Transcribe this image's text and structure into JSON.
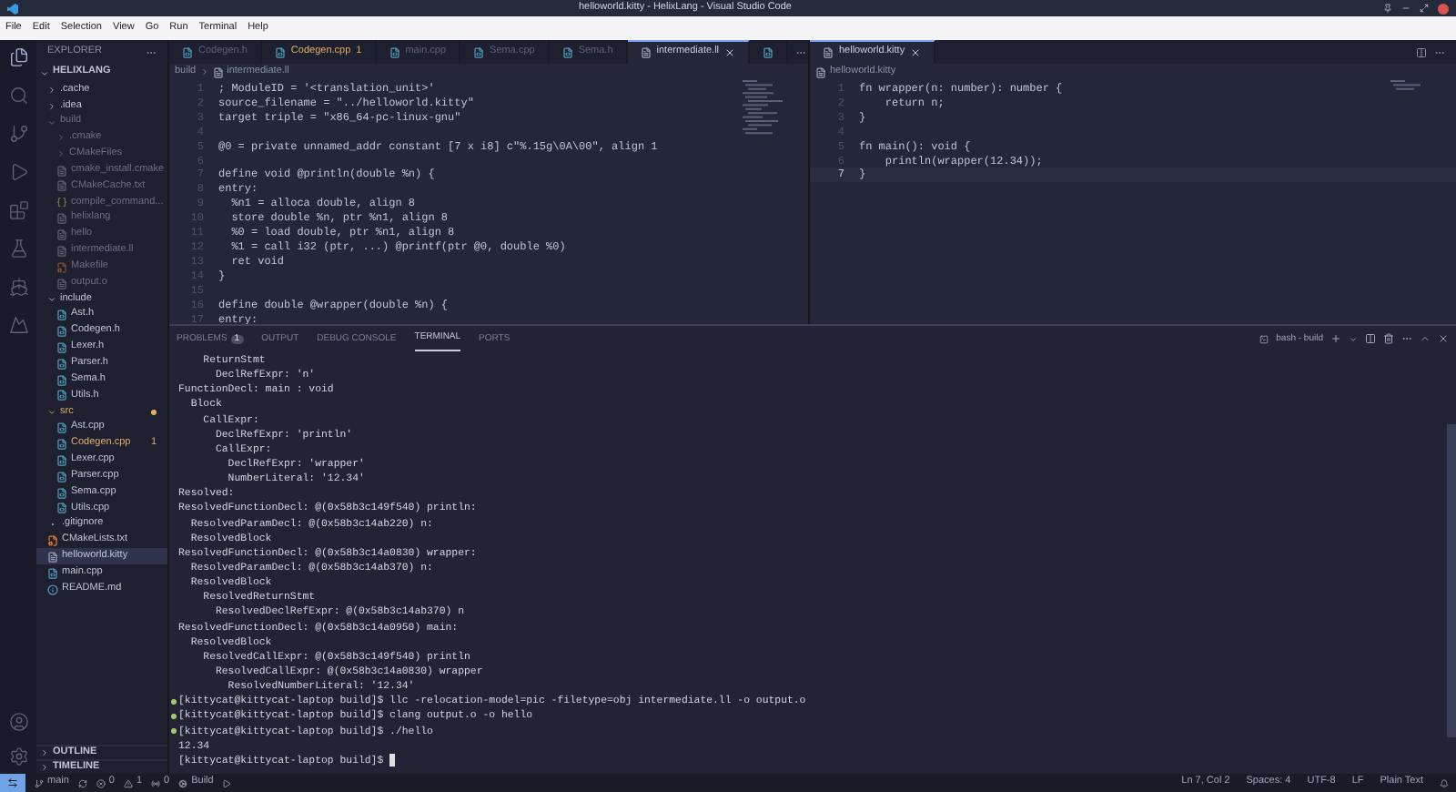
{
  "window": {
    "title": "helloworld.kitty - HelixLang - Visual Studio Code"
  },
  "menu": [
    "File",
    "Edit",
    "Selection",
    "View",
    "Go",
    "Run",
    "Terminal",
    "Help"
  ],
  "activity_bar": [
    {
      "kind": "files",
      "selected": true
    },
    {
      "kind": "search",
      "selected": false
    },
    {
      "kind": "branch",
      "selected": false
    },
    {
      "kind": "run",
      "selected": false
    },
    {
      "kind": "extensions",
      "selected": false
    },
    {
      "kind": "flask",
      "selected": false
    },
    {
      "kind": "ship",
      "selected": false
    },
    {
      "kind": "mountain",
      "selected": false
    }
  ],
  "explorer": {
    "title": "EXPLORER",
    "project": "HELIXLANG",
    "tree": [
      {
        "name": ".cache",
        "kind": "folder",
        "expanded": false,
        "dimmed": false
      },
      {
        "name": ".idea",
        "kind": "folder",
        "expanded": false,
        "dimmed": false
      },
      {
        "name": "build",
        "kind": "folder",
        "expanded": true,
        "dimmed": true,
        "children": [
          {
            "name": ".cmake",
            "kind": "folder",
            "expanded": false,
            "dimmed": true
          },
          {
            "name": "CMakeFiles",
            "kind": "folder",
            "expanded": false,
            "dimmed": true
          },
          {
            "name": "cmake_install.cmake",
            "kind": "text",
            "dimmed": true,
            "selected": false
          },
          {
            "name": "CMakeCache.txt",
            "kind": "text",
            "dimmed": true,
            "selected": false
          },
          {
            "name": "compile_command...",
            "kind": "json",
            "dimmed": true,
            "selected": false
          },
          {
            "name": "helixlang",
            "kind": "text",
            "dimmed": true,
            "selected": false
          },
          {
            "name": "hello",
            "kind": "text",
            "dimmed": true,
            "selected": false
          },
          {
            "name": "intermediate.ll",
            "kind": "text",
            "dimmed": true,
            "selected": false
          },
          {
            "name": "Makefile",
            "kind": "make",
            "dimmed": true,
            "selected": false
          },
          {
            "name": "output.o",
            "kind": "text",
            "dimmed": true,
            "selected": false
          }
        ]
      },
      {
        "name": "include",
        "kind": "folder",
        "expanded": true,
        "dimmed": false,
        "children": [
          {
            "name": "Ast.h",
            "kind": "c",
            "dimmed": false,
            "selected": false
          },
          {
            "name": "Codegen.h",
            "kind": "c",
            "dimmed": false,
            "selected": false
          },
          {
            "name": "Lexer.h",
            "kind": "c",
            "dimmed": false,
            "selected": false
          },
          {
            "name": "Parser.h",
            "kind": "c",
            "dimmed": false,
            "selected": false
          },
          {
            "name": "Sema.h",
            "kind": "c",
            "dimmed": false,
            "selected": false
          },
          {
            "name": "Utils.h",
            "kind": "c",
            "dimmed": false,
            "selected": false
          }
        ]
      },
      {
        "name": "src",
        "kind": "folder",
        "expanded": true,
        "dimmed": false,
        "error": true,
        "children": [
          {
            "name": "Ast.cpp",
            "kind": "c",
            "dimmed": false,
            "selected": false
          },
          {
            "name": "Codegen.cpp",
            "kind": "c",
            "dimmed": false,
            "selected": false,
            "error": true,
            "badge": "1"
          },
          {
            "name": "Lexer.cpp",
            "kind": "c",
            "dimmed": false,
            "selected": false
          },
          {
            "name": "Parser.cpp",
            "kind": "c",
            "dimmed": false,
            "selected": false
          },
          {
            "name": "Sema.cpp",
            "kind": "c",
            "dimmed": false,
            "selected": false
          },
          {
            "name": "Utils.cpp",
            "kind": "c",
            "dimmed": false,
            "selected": false
          }
        ]
      },
      {
        "name": ".gitignore",
        "kind": "git",
        "dimmed": false,
        "selected": false
      },
      {
        "name": "CMakeLists.txt",
        "kind": "make",
        "dimmed": false,
        "selected": false
      },
      {
        "name": "helloworld.kitty",
        "kind": "text",
        "dimmed": false,
        "selected": true
      },
      {
        "name": "main.cpp",
        "kind": "c",
        "dimmed": false,
        "selected": false
      },
      {
        "name": "README.md",
        "kind": "info",
        "dimmed": false,
        "selected": false
      }
    ],
    "sections": [
      "OUTLINE",
      "TIMELINE"
    ]
  },
  "editor_left": {
    "tabs": [
      {
        "label": "Codegen.h",
        "kind": "c",
        "selected": false
      },
      {
        "label": "Codegen.cpp",
        "kind": "c",
        "selected": false,
        "error": true,
        "badge": "1"
      },
      {
        "label": "main.cpp",
        "kind": "c",
        "selected": false
      },
      {
        "label": "Sema.cpp",
        "kind": "c",
        "selected": false
      },
      {
        "label": "Sema.h",
        "kind": "c",
        "selected": false
      },
      {
        "label": "intermediate.ll",
        "kind": "text",
        "selected": true
      },
      {
        "kind": "c",
        "selected": false
      }
    ],
    "breadcrumb": [
      "build",
      "intermediate.ll"
    ],
    "lines": [
      {
        "number": "1",
        "code": "; ModuleID = '<translation_unit>'"
      },
      {
        "number": "2",
        "code": "source_filename = \"../helloworld.kitty\""
      },
      {
        "number": "3",
        "code": "target triple = \"x86_64-pc-linux-gnu\""
      },
      {
        "number": "4"
      },
      {
        "number": "5",
        "code": "@0 = private unnamed_addr constant [7 x i8] c\"%.15g\\0A\\00\", align 1"
      },
      {
        "number": "6"
      },
      {
        "number": "7",
        "code": "define void @println(double %n) {"
      },
      {
        "number": "8",
        "code": "entry:"
      },
      {
        "number": "9",
        "code": "  %n1 = alloca double, align 8"
      },
      {
        "number": "10",
        "code": "  store double %n, ptr %n1, align 8"
      },
      {
        "number": "11",
        "code": "  %0 = load double, ptr %n1, align 8"
      },
      {
        "number": "12",
        "code": "  %1 = call i32 (ptr, ...) @printf(ptr @0, double %0)"
      },
      {
        "number": "13",
        "code": "  ret void"
      },
      {
        "number": "14",
        "code": "}"
      },
      {
        "number": "15"
      },
      {
        "number": "16",
        "code": "define double @wrapper(double %n) {"
      },
      {
        "number": "17",
        "code": "entry:"
      }
    ]
  },
  "editor_right": {
    "tabs": [
      {
        "label": "helloworld.kitty",
        "kind": "text",
        "selected": true
      }
    ],
    "breadcrumb": [
      "helloworld.kitty"
    ],
    "lines": [
      {
        "number": "1",
        "code": "fn wrapper(n: number): number {",
        "current": false
      },
      {
        "number": "2",
        "code": "    return n;",
        "current": false
      },
      {
        "number": "3",
        "code": "}",
        "current": false
      },
      {
        "number": "4",
        "current": false
      },
      {
        "number": "5",
        "code": "fn main(): void {",
        "current": false
      },
      {
        "number": "6",
        "code": "    println(wrapper(12.34));",
        "current": false
      },
      {
        "number": "7",
        "code": "}",
        "current": true
      }
    ]
  },
  "panel": {
    "tabs": [
      {
        "label": "PROBLEMS",
        "badge": "1",
        "selected": false
      },
      {
        "label": "OUTPUT",
        "selected": false
      },
      {
        "label": "DEBUG CONSOLE",
        "selected": false
      },
      {
        "label": "TERMINAL",
        "selected": true
      },
      {
        "label": "PORTS",
        "selected": false
      }
    ],
    "terminal_name": "bash - build",
    "lines": [
      {
        "kind": "output",
        "text": "    ReturnStmt"
      },
      {
        "kind": "output",
        "text": "      DeclRefExpr: 'n'"
      },
      {
        "kind": "output",
        "text": "FunctionDecl: main : void"
      },
      {
        "kind": "output",
        "text": "  Block"
      },
      {
        "kind": "output",
        "text": "    CallExpr:"
      },
      {
        "kind": "output",
        "text": "      DeclRefExpr: 'println'"
      },
      {
        "kind": "output",
        "text": "      CallExpr:"
      },
      {
        "kind": "output",
        "text": "        DeclRefExpr: 'wrapper'"
      },
      {
        "kind": "output",
        "text": "        NumberLiteral: '12.34'"
      },
      {
        "kind": "output",
        "text": "Resolved:"
      },
      {
        "kind": "output",
        "text": "ResolvedFunctionDecl: @(0x58b3c149f540) println:"
      },
      {
        "kind": "output",
        "text": "  ResolvedParamDecl: @(0x58b3c14ab220) n:"
      },
      {
        "kind": "output",
        "text": "  ResolvedBlock"
      },
      {
        "kind": "output",
        "text": "ResolvedFunctionDecl: @(0x58b3c14a0830) wrapper:"
      },
      {
        "kind": "output",
        "text": "  ResolvedParamDecl: @(0x58b3c14ab370) n:"
      },
      {
        "kind": "output",
        "text": "  ResolvedBlock"
      },
      {
        "kind": "output",
        "text": "    ResolvedReturnStmt"
      },
      {
        "kind": "output",
        "text": "      ResolvedDeclRefExpr: @(0x58b3c14ab370) n"
      },
      {
        "kind": "output",
        "text": "ResolvedFunctionDecl: @(0x58b3c14a0950) main:"
      },
      {
        "kind": "output",
        "text": "  ResolvedBlock"
      },
      {
        "kind": "output",
        "text": "    ResolvedCallExpr: @(0x58b3c149f540) println"
      },
      {
        "kind": "output",
        "text": "      ResolvedCallExpr: @(0x58b3c14a0830) wrapper"
      },
      {
        "kind": "output",
        "text": "        ResolvedNumberLiteral: '12.34'"
      },
      {
        "kind": "command",
        "text": "[kittycat@kittycat-laptop build]$ llc -relocation-model=pic -filetype=obj intermediate.ll -o output.o"
      },
      {
        "kind": "command",
        "text": "[kittycat@kittycat-laptop build]$ clang output.o -o hello"
      },
      {
        "kind": "command",
        "text": "[kittycat@kittycat-laptop build]$ ./hello"
      },
      {
        "kind": "output",
        "text": "12.34"
      },
      {
        "kind": "prompt",
        "text": "[kittycat@kittycat-laptop build]$"
      }
    ]
  },
  "status_bar": {
    "branch": "main",
    "errors": "0",
    "warnings": "1",
    "ports": "0",
    "task": "Build",
    "position": "Ln 7, Col 2",
    "indent": "Spaces: 4",
    "encoding": "UTF-8",
    "eol": "LF",
    "language": "Plain Text"
  }
}
